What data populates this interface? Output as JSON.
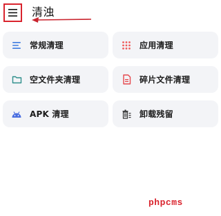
{
  "header": {
    "title": "清浊",
    "menu_icon": "hamburger-menu-icon"
  },
  "cards": [
    {
      "id": "regular-cleanup",
      "label": "常规清理",
      "icon": "lines-icon",
      "color": "#3d7be0"
    },
    {
      "id": "app-cleanup",
      "label": "应用清理",
      "icon": "dots-grid-icon",
      "color": "#ef5a5a"
    },
    {
      "id": "empty-folder-cleanup",
      "label": "空文件夹清理",
      "icon": "folder-icon",
      "color": "#2f8f8c"
    },
    {
      "id": "fragment-file-cleanup",
      "label": "碎片文件清理",
      "icon": "document-icon",
      "color": "#e5484d"
    },
    {
      "id": "apk-cleanup",
      "label": "APK 清理",
      "icon": "android-icon",
      "color": "#4a6ee0"
    },
    {
      "id": "uninstall-leftovers",
      "label": "卸载残留",
      "icon": "trash-icon",
      "color": "#333333"
    }
  ],
  "watermark": {
    "text": "phpcms",
    "color": "#d9232d"
  },
  "colors": {
    "accent_red": "#d9232d",
    "card_bg": "#f3f4f7"
  }
}
